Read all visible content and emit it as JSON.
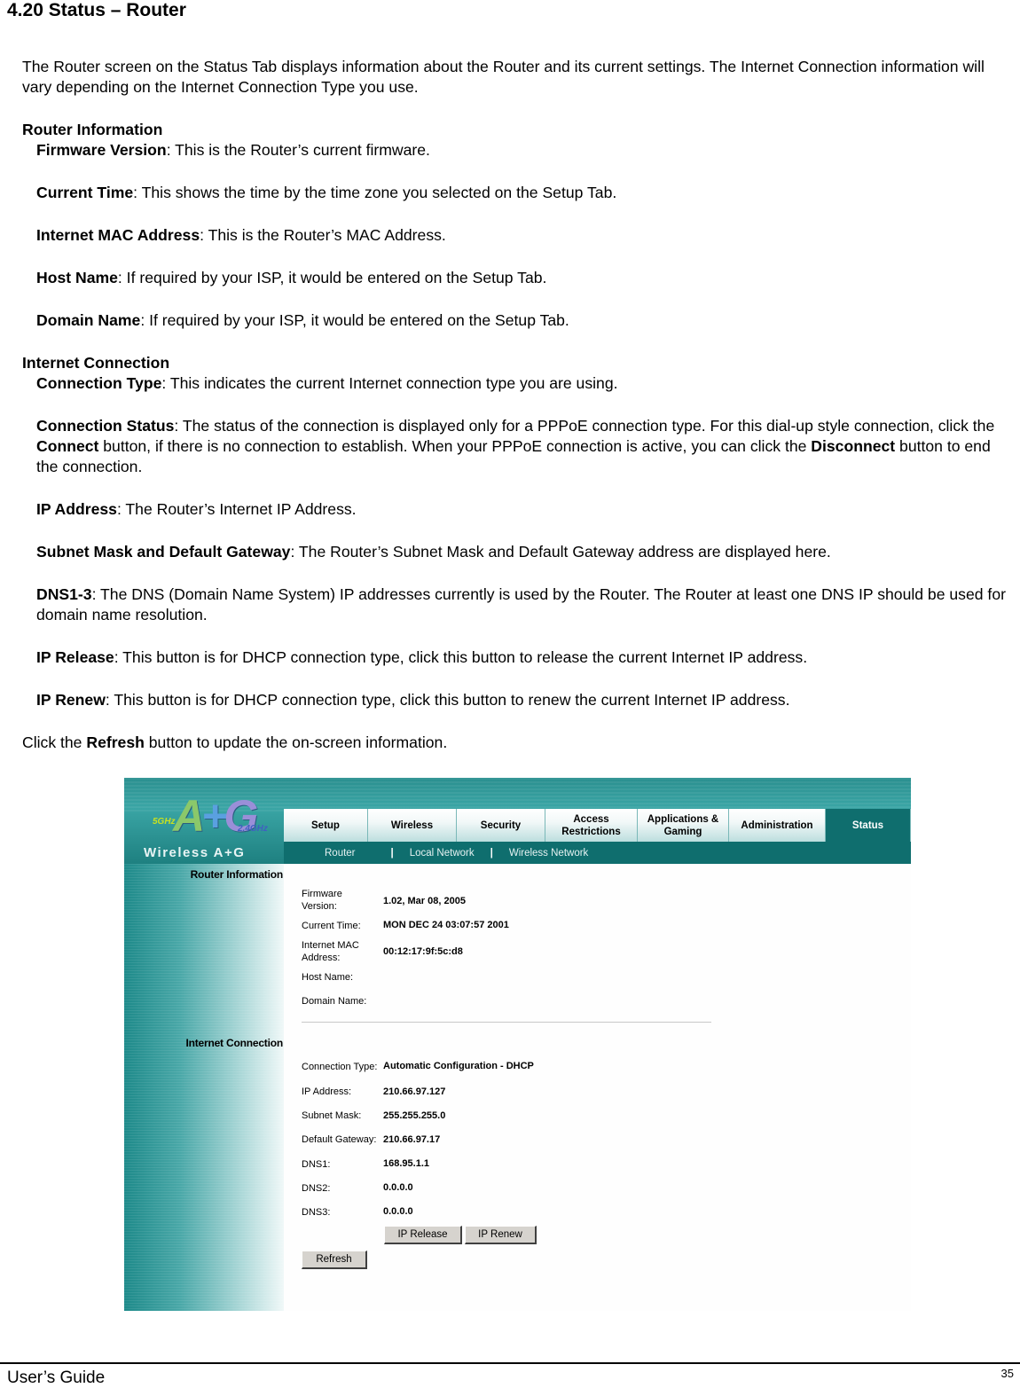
{
  "heading": "4.20 Status – Router",
  "intro": "The Router screen on the Status Tab displays information about the Router and its current settings. The Internet Connection information will vary depending on the Internet Connection Type you use.",
  "sections": {
    "router_info": {
      "title": "Router Information",
      "items": [
        {
          "term": "Firmware Version",
          "desc": ": This is the Router’s current firmware."
        },
        {
          "term": "Current Time",
          "desc": ": This shows the time by the time zone you selected on the Setup Tab."
        },
        {
          "term": "Internet MAC Address",
          "desc": ": This is the Router’s MAC Address."
        },
        {
          "term": "Host Name",
          "desc": ": If required by your ISP, it would be entered on the Setup Tab."
        },
        {
          "term": "Domain Name",
          "desc": ": If required by your ISP, it would be entered on the Setup Tab."
        }
      ]
    },
    "internet_conn": {
      "title": "Internet Connection",
      "connection_type": {
        "term": "Connection Type",
        "desc": ": This indicates the current Internet connection type you are using."
      },
      "connection_status": {
        "term": "Connection Status",
        "desc1": ": The status of the connection is displayed only for a PPPoE connection type. For this dial-up style connection, click the ",
        "connect": "Connect",
        "desc2": " button, if there is no connection to establish. When your PPPoE connection is active, you can click the ",
        "disconnect": "Disconnect",
        "desc3": " button to end the connection."
      },
      "ip_address": {
        "term": "IP Address",
        "desc": ": The Router’s Internet IP Address."
      },
      "subnet_gateway": {
        "term": "Subnet Mask and Default Gateway",
        "desc": ": The Router’s Subnet Mask and Default Gateway address are displayed here."
      },
      "dns": {
        "term": "DNS1-3",
        "desc": ": The DNS (Domain Name System) IP addresses currently is used by the Router. The Router at least one DNS IP should be used for domain name resolution."
      },
      "ip_release": {
        "term": "IP Release",
        "desc": ": This button is for DHCP connection type, click this button to release the current Internet IP address."
      },
      "ip_renew": {
        "term": "IP Renew",
        "desc": ": This button is for DHCP connection type, click this button to renew the current Internet IP address."
      }
    },
    "refresh": {
      "pre": "Click the ",
      "term": "Refresh",
      "post": " button to update the on-screen information."
    }
  },
  "screenshot": {
    "logo": {
      "left": "5GHz",
      "letters": "A",
      "plus": "+",
      "g": "G",
      "right": "2.4GHz",
      "product": "Wireless A+G"
    },
    "tabs": [
      {
        "label": "Setup"
      },
      {
        "label": "Wireless"
      },
      {
        "label": "Security"
      },
      {
        "label": "Access Restrictions"
      },
      {
        "label": "Applications & Gaming"
      },
      {
        "label": "Administration"
      },
      {
        "label": "Status",
        "active": true
      }
    ],
    "subtabs": [
      "Router",
      "Local Network",
      "Wireless Network"
    ],
    "subtab_separator": "|",
    "router_info_title": "Router Information",
    "internet_conn_title": "Internet Connection",
    "fields": {
      "firmware_label": "Firmware Version:",
      "firmware_value": "1.02, Mar 08, 2005",
      "time_label": "Current Time:",
      "time_value": "MON DEC 24 03:07:57 2001",
      "mac_label": "Internet MAC Address:",
      "mac_value": "00:12:17:9f:5c:d8",
      "host_label": "Host Name:",
      "host_value": "",
      "domain_label": "Domain Name:",
      "domain_value": "",
      "conn_type_label": "Connection Type:",
      "conn_type_value": "Automatic Configuration - DHCP",
      "ip_label": "IP Address:",
      "ip_value": "210.66.97.127",
      "subnet_label": "Subnet Mask:",
      "subnet_value": "255.255.255.0",
      "gateway_label": "Default Gateway:",
      "gateway_value": "210.66.97.17",
      "dns1_label": "DNS1:",
      "dns1_value": "168.95.1.1",
      "dns2_label": "DNS2:",
      "dns2_value": "0.0.0.0",
      "dns3_label": "DNS3:",
      "dns3_value": "0.0.0.0"
    },
    "buttons": {
      "ip_release": "IP Release",
      "ip_renew": "IP Renew",
      "refresh": "Refresh"
    },
    "colors": {
      "teal_dark": "#0f6e6e",
      "teal": "#2a8f8f",
      "button_face": "#d6d3ce"
    }
  },
  "footer": {
    "left": "User’s Guide",
    "page": "35"
  }
}
